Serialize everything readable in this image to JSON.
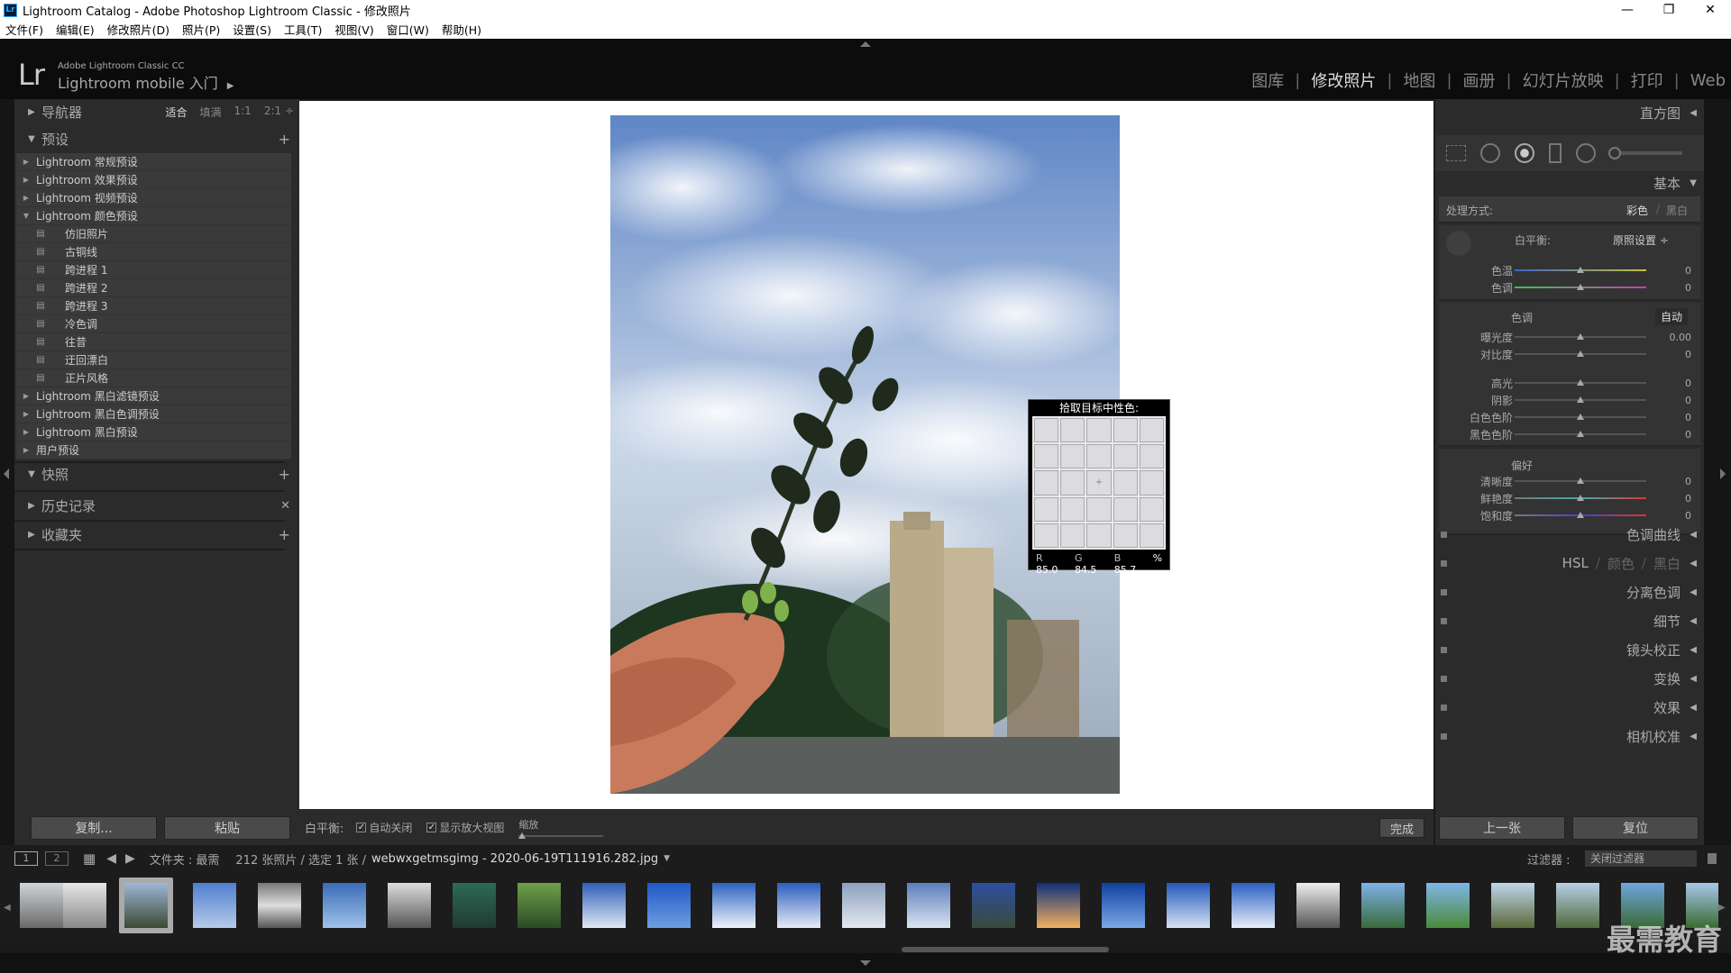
{
  "window": {
    "title": "Lightroom Catalog - Adobe Photoshop Lightroom Classic - 修改照片",
    "app_icon_text": "Lr"
  },
  "menu": [
    "文件(F)",
    "编辑(E)",
    "修改照片(D)",
    "照片(P)",
    "设置(S)",
    "工具(T)",
    "视图(V)",
    "窗口(W)",
    "帮助(H)"
  ],
  "brand": {
    "logo": "Lr",
    "product": "Adobe Lightroom Classic CC",
    "identity": "Lightroom mobile 入门",
    "play_icon": "play-triangle"
  },
  "modules": [
    {
      "label": "图库",
      "active": false
    },
    {
      "label": "修改照片",
      "active": true
    },
    {
      "label": "地图",
      "active": false
    },
    {
      "label": "画册",
      "active": false
    },
    {
      "label": "幻灯片放映",
      "active": false
    },
    {
      "label": "打印",
      "active": false
    },
    {
      "label": "Web",
      "active": false
    }
  ],
  "left": {
    "navigator": {
      "title": "导航器",
      "options": [
        "适合",
        "填满",
        "1:1",
        "2:1 ÷"
      ],
      "active": "适合"
    },
    "presets": {
      "title": "预设",
      "items": [
        {
          "label": "Lightroom 常规预设",
          "expanded": false,
          "sub": false
        },
        {
          "label": "Lightroom 效果预设",
          "expanded": false,
          "sub": false
        },
        {
          "label": "Lightroom 视频预设",
          "expanded": false,
          "sub": false
        },
        {
          "label": "Lightroom 颜色预设",
          "expanded": true,
          "sub": false
        },
        {
          "label": "仿旧照片",
          "sub": true
        },
        {
          "label": "古铜线",
          "sub": true
        },
        {
          "label": "跨进程 1",
          "sub": true
        },
        {
          "label": "跨进程 2",
          "sub": true
        },
        {
          "label": "跨进程 3",
          "sub": true
        },
        {
          "label": "冷色调",
          "sub": true
        },
        {
          "label": "往昔",
          "sub": true
        },
        {
          "label": "迂回漂白",
          "sub": true
        },
        {
          "label": "正片风格",
          "sub": true
        },
        {
          "label": "Lightroom 黑白滤镜预设",
          "expanded": false,
          "sub": false
        },
        {
          "label": "Lightroom 黑白色调预设",
          "expanded": false,
          "sub": false
        },
        {
          "label": "Lightroom 黑白预设",
          "expanded": false,
          "sub": false
        },
        {
          "label": "用户预设",
          "expanded": false,
          "sub": false
        }
      ]
    },
    "snapshots": "快照",
    "history": "历史记录",
    "collections": "收藏夹",
    "copy_button": "复制...",
    "paste_button": "粘贴"
  },
  "loupe": {
    "caption": "拾取目标中性色:",
    "r_label": "R",
    "r": "85.0",
    "g_label": "G",
    "g": "84.5",
    "b_label": "B",
    "b": "85.7",
    "unit": "%"
  },
  "toolbar": {
    "wb_label": "白平衡:",
    "auto_close": "自动关闭",
    "show_loupe": "显示放大视图",
    "zoom_label": "缩放",
    "done": "完成"
  },
  "right": {
    "histogram": "直方图",
    "basic": "基本",
    "treatment_label": "处理方式:",
    "treatment_color": "彩色",
    "treatment_bw": "黑白",
    "wb_label": "白平衡:",
    "wb_value": "原照设置 ÷",
    "wb_sliders": [
      {
        "label": "色温",
        "value": "0"
      },
      {
        "label": "色调",
        "value": "0"
      }
    ],
    "tone_label": "色调",
    "auto": "自动",
    "tone_sliders": [
      {
        "label": "曝光度",
        "value": "0.00"
      },
      {
        "label": "对比度",
        "value": "0"
      }
    ],
    "tone_sliders2": [
      {
        "label": "高光",
        "value": "0"
      },
      {
        "label": "阴影",
        "value": "0"
      },
      {
        "label": "白色色阶",
        "value": "0"
      },
      {
        "label": "黑色色阶",
        "value": "0"
      }
    ],
    "presence_label": "偏好",
    "presence_sliders": [
      {
        "label": "清晰度",
        "value": "0"
      },
      {
        "label": "鲜艳度",
        "value": "0"
      },
      {
        "label": "饱和度",
        "value": "0"
      }
    ],
    "panels": [
      "色调曲线",
      "HSL / 颜色 / 黑白",
      "分离色调",
      "细节",
      "镜头校正",
      "变换",
      "效果",
      "相机校准"
    ],
    "hsl": "HSL",
    "hsl_color": "颜色",
    "hsl_bw": "黑白",
    "prev_button": "上一张",
    "reset_button": "复位"
  },
  "filmstrip": {
    "page1": "1",
    "page2": "2",
    "source_label": "文件夹 : 最需",
    "count": "212 张照片 / 选定 1 张 /",
    "filename": "webwxgetmsgimg - 2020-06-19T111916.282.jpg",
    "filter_label": "过滤器 :",
    "filter_value": "关闭过滤器",
    "thumb_count": 26,
    "selected_index": 2
  },
  "watermark": "最需教育",
  "colors": {
    "panel": "#2b2b2b",
    "background": "#1a1a1a",
    "active_module": "#dddddd"
  }
}
